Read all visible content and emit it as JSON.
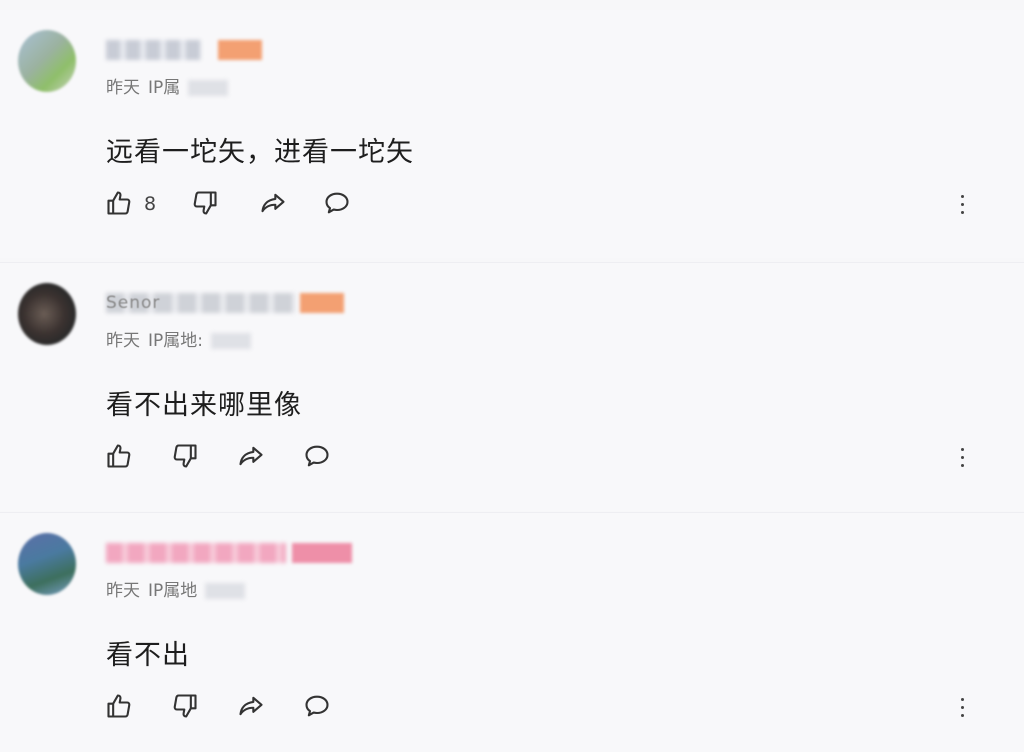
{
  "comments": [
    {
      "username_visible": "",
      "meta": {
        "time": "昨天",
        "ip_label": "IP属"
      },
      "text": "远看一坨矢，进看一坨矢",
      "like_count": "8"
    },
    {
      "username_visible": "Senor",
      "meta": {
        "time": "昨天",
        "ip_label": "IP属地:"
      },
      "text": "看不出来哪里像",
      "like_count": ""
    },
    {
      "username_visible": "",
      "meta": {
        "time": "昨天",
        "ip_label": "IP属地"
      },
      "text": "看不出",
      "like_count": ""
    }
  ],
  "icons": {
    "like": "thumbs-up-icon",
    "dislike": "thumbs-down-icon",
    "share": "share-arrow-icon",
    "reply": "chat-bubble-icon",
    "more": "more-vertical-icon"
  },
  "colors": {
    "background": "#f8f8fa",
    "text": "#1e1e1e",
    "meta": "#777777",
    "level_badge": "#f3a072",
    "pink_name": "#f2a7c0"
  }
}
